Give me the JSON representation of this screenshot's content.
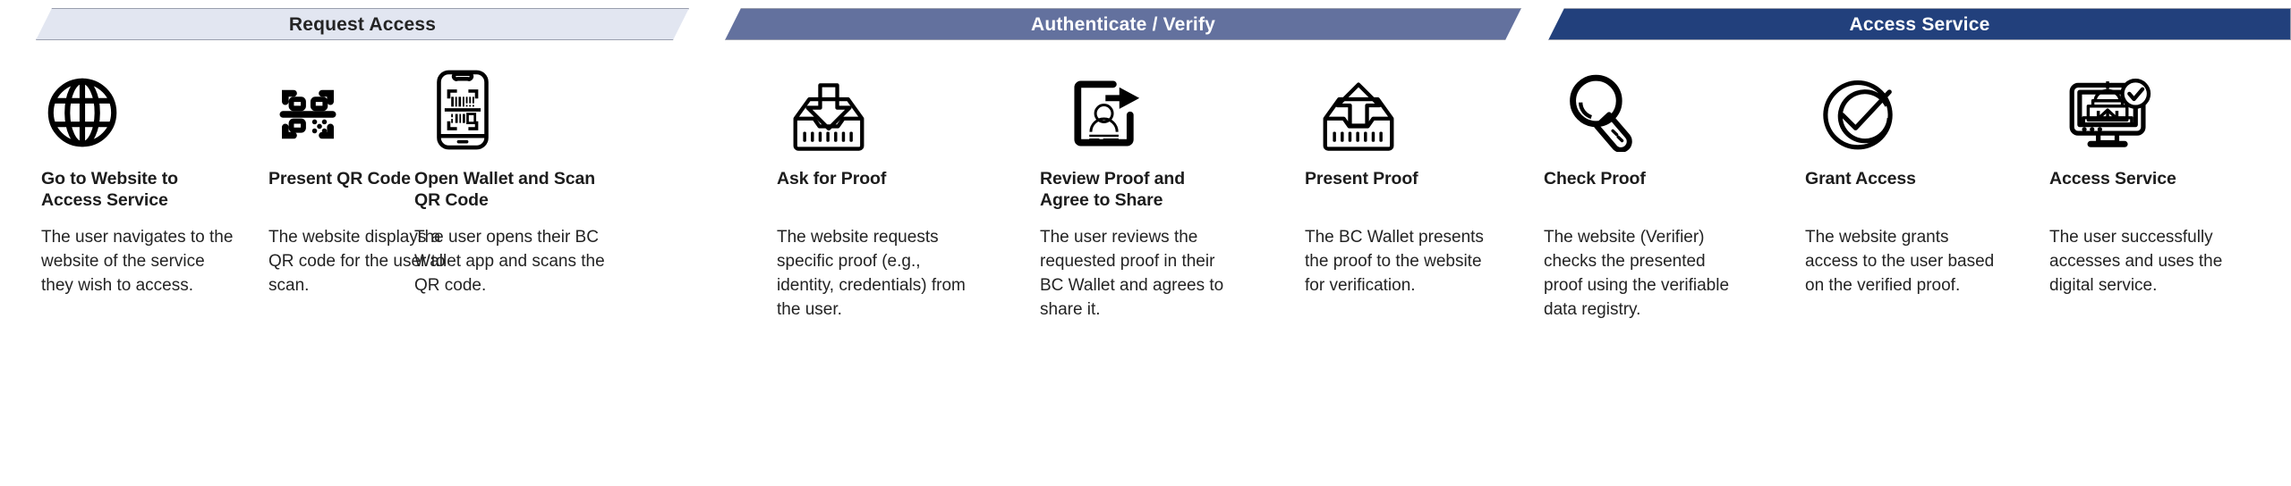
{
  "phases": [
    {
      "id": "request-access",
      "label": "Request Access",
      "bg": "#e2e6f1",
      "fg": "#242424"
    },
    {
      "id": "authenticate-verify",
      "label": "Authenticate / Verify",
      "bg": "#63719e",
      "fg": "#ffffff"
    },
    {
      "id": "access-service",
      "label": "Access Service",
      "bg": "#22407c",
      "fg": "#ffffff"
    }
  ],
  "steps": [
    {
      "icon": "globe-icon",
      "title": "Go to Website to Access Service",
      "body": "The user navigates to the website of the service they wish to access."
    },
    {
      "icon": "qr-code-icon",
      "title": "Present QR Code",
      "body": "The website displays a QR code for the user to scan."
    },
    {
      "icon": "phone-scan-qr-icon",
      "title": "Open Wallet and Scan QR Code",
      "body": "The user opens their BC Wallet app and scans the QR code."
    },
    {
      "icon": "inbox-download-icon",
      "title": "Ask for Proof",
      "body": "The website requests specific proof (e.g., identity, credentials) from the user."
    },
    {
      "icon": "id-card-share-icon",
      "title": "Review Proof and Agree to Share",
      "body": "The user reviews the requested proof in their BC Wallet and agrees to share it."
    },
    {
      "icon": "outbox-upload-icon",
      "title": "Present Proof",
      "body": "The BC Wallet presents the proof to the website for verification."
    },
    {
      "icon": "magnifier-icon",
      "title": "Check Proof",
      "body": "The website (Verifier) checks the presented proof using the verifiable data registry."
    },
    {
      "icon": "check-circle-icon",
      "title": "Grant Access",
      "body": "The website grants access to the user based on the verified proof."
    },
    {
      "icon": "monitor-government-verified-icon",
      "title": "Access Service",
      "body": "The user successfully accesses and uses the digital service."
    }
  ]
}
